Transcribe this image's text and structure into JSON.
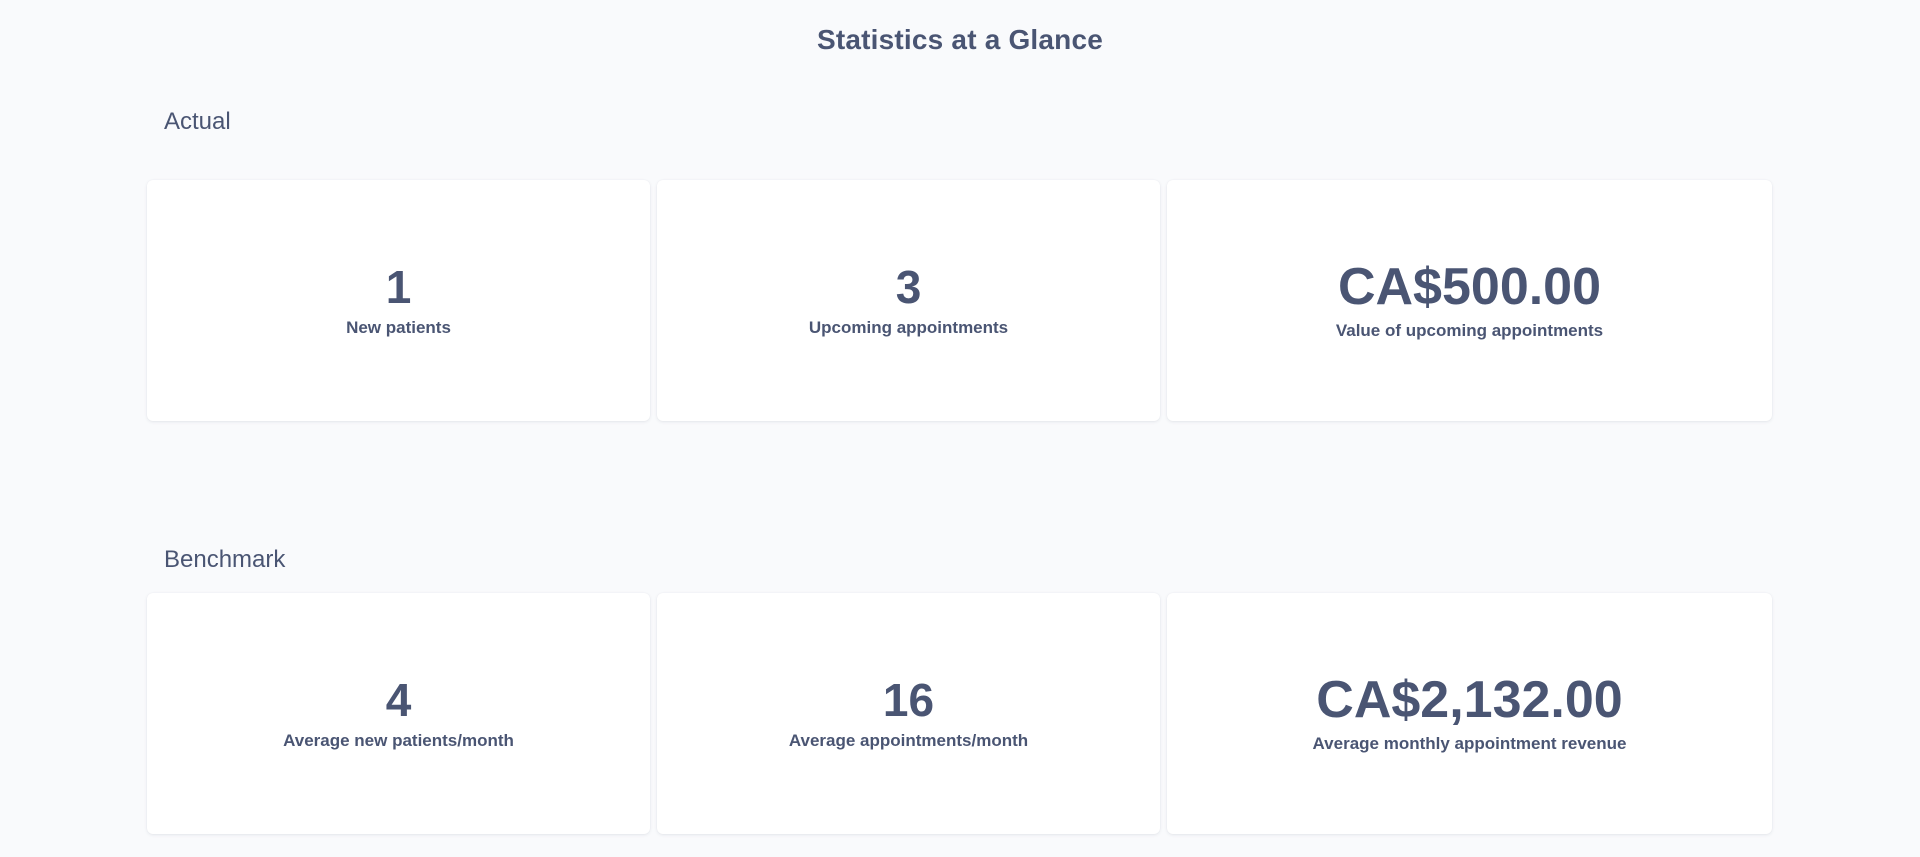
{
  "page": {
    "title": "Statistics at a Glance"
  },
  "actual": {
    "heading": "Actual",
    "stats": [
      {
        "value": "1",
        "label": "New patients"
      },
      {
        "value": "3",
        "label": "Upcoming appointments"
      },
      {
        "value": "CA$500.00",
        "label": "Value of upcoming appointments"
      }
    ]
  },
  "benchmark": {
    "heading": "Benchmark",
    "stats": [
      {
        "value": "4",
        "label": "Average new patients/month"
      },
      {
        "value": "16",
        "label": "Average appointments/month"
      },
      {
        "value": "CA$2,132.00",
        "label": "Average monthly appointment revenue"
      }
    ]
  },
  "colors": {
    "background": "#f9fafc",
    "card": "#ffffff",
    "text": "#4a5573"
  }
}
